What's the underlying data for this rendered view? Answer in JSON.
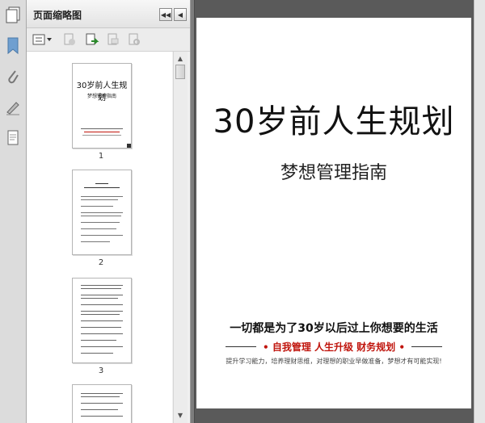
{
  "sidebar_panel": {
    "title": "页面缩略图",
    "collapse_label": "◀◀",
    "close_label": "◀"
  },
  "thumbnails": [
    {
      "number": "1",
      "title": "30岁前人生规划",
      "subtitle": "梦想管理指南"
    },
    {
      "number": "2"
    },
    {
      "number": "3"
    }
  ],
  "document": {
    "title": "30岁前人生规划",
    "subtitle": "梦想管理指南",
    "slogan": "一切都是为了30岁以后过上你想要的生活",
    "tags": "• 自我管理  人生升级  财务规划 •",
    "description": "提升学习能力，培养理财思维，对理想的职业早做准备，梦想才有可能实现!"
  },
  "colors": {
    "tag_red": "#c0140c",
    "window_gray": "#5a5a5a"
  }
}
